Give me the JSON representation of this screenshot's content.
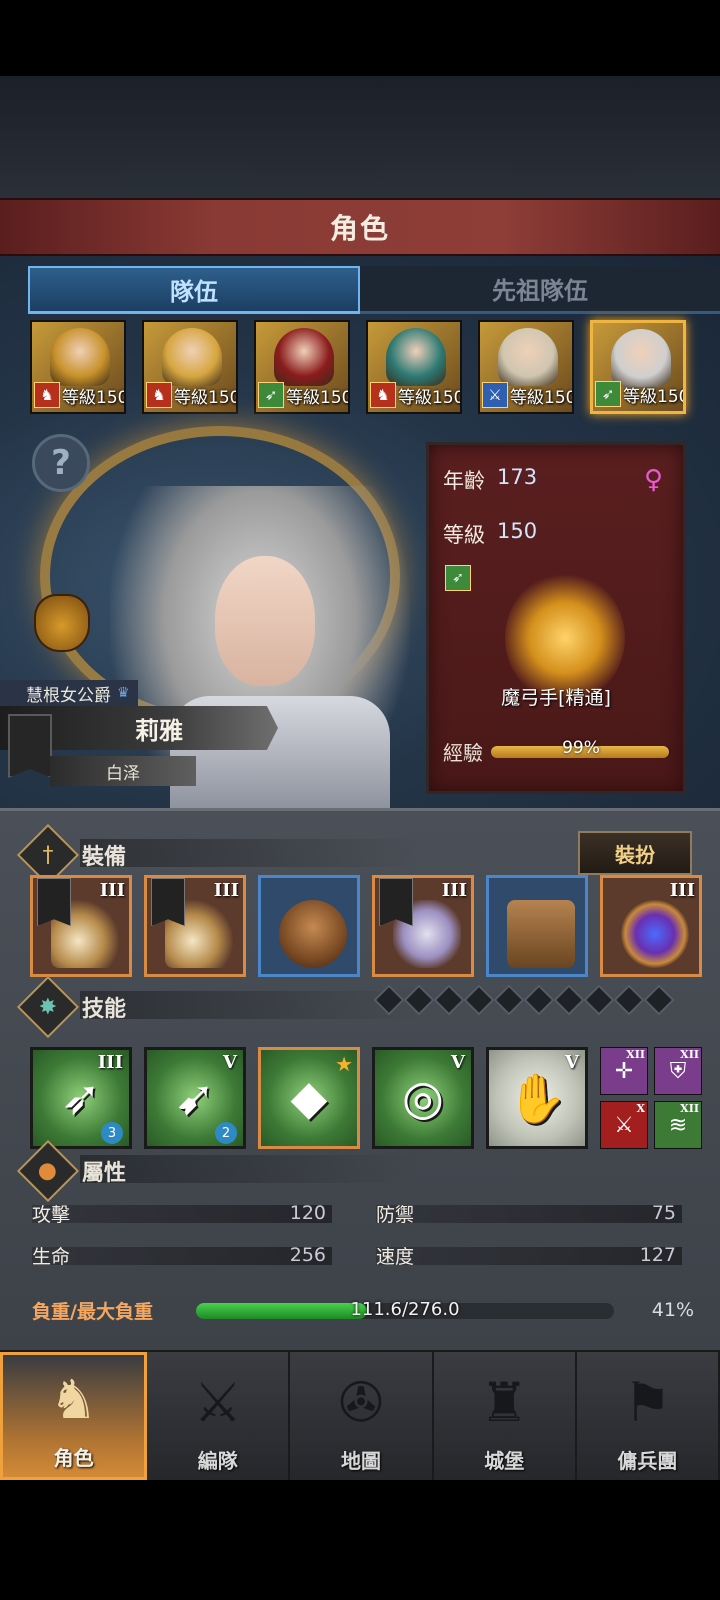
{
  "title": "角色",
  "tabs": [
    {
      "label": "隊伍",
      "active": true
    },
    {
      "label": "先祖隊伍",
      "active": false
    }
  ],
  "roster": [
    {
      "level_text": "等級150",
      "class_icon": "horse-icon",
      "class_color": "#b6301c"
    },
    {
      "level_text": "等級150",
      "class_icon": "horse-icon",
      "class_color": "#b6301c"
    },
    {
      "level_text": "等級150",
      "class_icon": "bow-icon",
      "class_color": "#3c8a3a"
    },
    {
      "level_text": "等級150",
      "class_icon": "horse-icon",
      "class_color": "#b6301c"
    },
    {
      "level_text": "等級150",
      "class_icon": "sword-icon",
      "class_color": "#2f5fb0"
    },
    {
      "level_text": "等級150",
      "class_icon": "bow-icon",
      "class_color": "#3c8a3a",
      "selected": true
    }
  ],
  "hero": {
    "title": "慧根女公爵",
    "name": "莉雅",
    "faction": "白泽"
  },
  "stats": {
    "age_label": "年齡",
    "age": "173",
    "level_label": "等級",
    "level": "150",
    "class_name": "魔弓手[精通]",
    "exp_label": "經驗",
    "exp_text": "99%",
    "exp_fraction": 0.99
  },
  "equipment": {
    "title": "裝備",
    "dress_button": "裝扮",
    "slots": [
      {
        "tier": "III",
        "name": "ornate-bow-icon"
      },
      {
        "tier": "III",
        "name": "ornate-bow-icon"
      },
      {
        "tier": "",
        "name": "helmet-icon"
      },
      {
        "tier": "III",
        "name": "armor-icon"
      },
      {
        "tier": "",
        "name": "boots-icon"
      },
      {
        "tier": "III",
        "name": "orb-icon"
      }
    ]
  },
  "skills": {
    "title": "技能",
    "rank_dots": 10,
    "items": [
      {
        "tier": "III",
        "glyph": "➶",
        "gem": "3",
        "style": "green",
        "name": "bow-aura-skill-icon"
      },
      {
        "tier": "V",
        "glyph": "➹",
        "gem": "2",
        "style": "green",
        "name": "bow-cursor-skill-icon"
      },
      {
        "tier": "",
        "glyph": "◆",
        "gem": "",
        "style": "green",
        "star": "★",
        "name": "crystal-arrow-skill-icon"
      },
      {
        "tier": "V",
        "glyph": "◎",
        "gem": "",
        "style": "green",
        "name": "crosshair-skill-icon"
      },
      {
        "tier": "V",
        "glyph": "✋",
        "gem": "",
        "style": "white",
        "name": "crystal-hand-skill-icon"
      }
    ],
    "passives": [
      {
        "tier": "XII",
        "glyph": "✛",
        "color": "#7a3d8c"
      },
      {
        "tier": "XII",
        "glyph": "⛨",
        "color": "#7a3d8c"
      },
      {
        "tier": "X",
        "glyph": "⚔",
        "color": "#a31f1f"
      },
      {
        "tier": "XII",
        "glyph": "≋",
        "color": "#3d7a36"
      }
    ]
  },
  "attributes": {
    "title": "屬性",
    "attack_label": "攻擊",
    "attack": "120",
    "defense_label": "防禦",
    "defense": "75",
    "hp_label": "生命",
    "hp": "256",
    "speed_label": "速度",
    "speed": "127",
    "load_label": "負重/最大負重",
    "load_text": "111.6/276.0",
    "load_pct": "41%",
    "load_fraction": 0.41
  },
  "nav": [
    {
      "label": "角色",
      "icon": "knight-icon",
      "glyph": "♞",
      "active": true
    },
    {
      "label": "編隊",
      "icon": "formation-icon",
      "glyph": "⚔",
      "active": false
    },
    {
      "label": "地圖",
      "icon": "compass-icon",
      "glyph": "✇",
      "active": false
    },
    {
      "label": "城堡",
      "icon": "castle-icon",
      "glyph": "♜",
      "active": false
    },
    {
      "label": "傭兵團",
      "icon": "mercenary-icon",
      "glyph": "⚑",
      "active": false
    }
  ]
}
